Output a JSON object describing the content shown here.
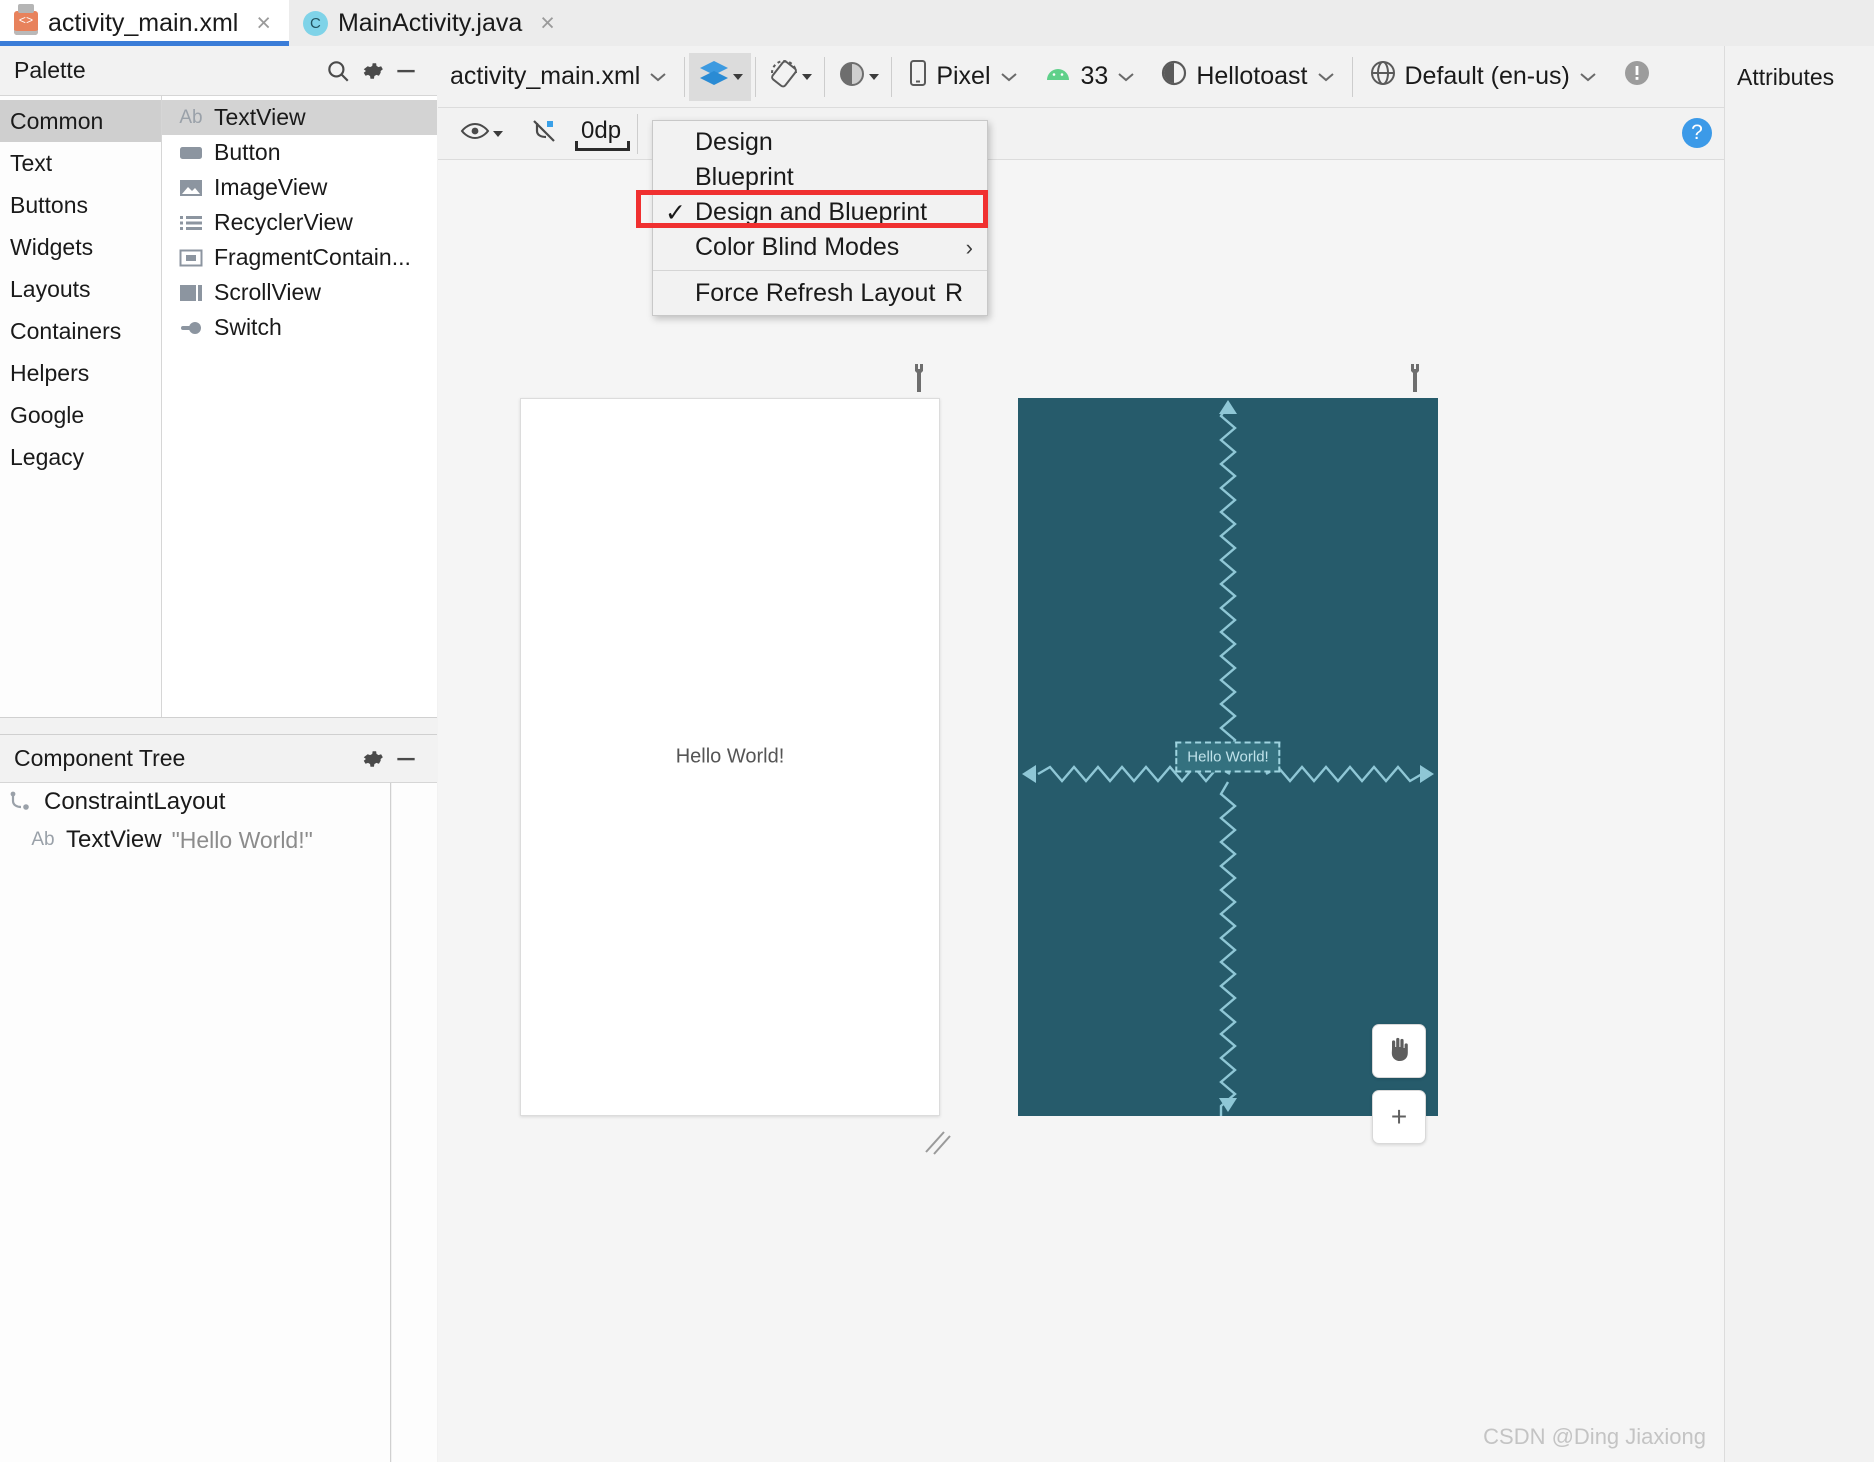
{
  "tabs": [
    {
      "label": "activity_main.xml",
      "icon": "xml-file-icon",
      "active": true,
      "close": "×"
    },
    {
      "label": "MainActivity.java",
      "icon": "java-class-icon",
      "active": false,
      "close": "×"
    }
  ],
  "palette": {
    "title": "Palette",
    "search_icon": "search-icon",
    "gear_icon": "gear-icon",
    "minimize_icon": "minimize-icon",
    "categories": [
      {
        "label": "Common",
        "selected": true
      },
      {
        "label": "Text",
        "selected": false
      },
      {
        "label": "Buttons",
        "selected": false
      },
      {
        "label": "Widgets",
        "selected": false
      },
      {
        "label": "Layouts",
        "selected": false
      },
      {
        "label": "Containers",
        "selected": false
      },
      {
        "label": "Helpers",
        "selected": false
      },
      {
        "label": "Google",
        "selected": false
      },
      {
        "label": "Legacy",
        "selected": false
      }
    ],
    "widgets": [
      {
        "label": "TextView",
        "icon": "textview-icon",
        "selected": true
      },
      {
        "label": "Button",
        "icon": "button-icon",
        "selected": false
      },
      {
        "label": "ImageView",
        "icon": "imageview-icon",
        "selected": false
      },
      {
        "label": "RecyclerView",
        "icon": "recyclerview-icon",
        "selected": false
      },
      {
        "label": "FragmentContain...",
        "icon": "fragmentcontainer-icon",
        "selected": false
      },
      {
        "label": "ScrollView",
        "icon": "scrollview-icon",
        "selected": false
      },
      {
        "label": "Switch",
        "icon": "switch-icon",
        "selected": false
      }
    ]
  },
  "component_tree": {
    "title": "Component Tree",
    "gear_icon": "gear-icon",
    "minimize_icon": "minimize-icon",
    "nodes": [
      {
        "label": "ConstraintLayout",
        "value": "",
        "icon": "constraintlayout-icon",
        "level": 0
      },
      {
        "label": "TextView",
        "value": "\"Hello World!\"",
        "icon": "textview-icon",
        "level": 1
      }
    ]
  },
  "toolbar": {
    "file_selector": "activity_main.xml",
    "surface_mode_icon": "design-surface-layers-icon",
    "orientation_icon": "rotate-device-icon",
    "theme_icon": "theme-contrast-icon",
    "device": "Pixel",
    "device_icon": "phone-icon",
    "api_level": "33",
    "api_icon": "android-icon",
    "theme": "Hellotoast",
    "locale": "Default (en-us)",
    "locale_icon": "globe-icon",
    "issues_icon": "warning-icon",
    "attributes_label": "Attributes"
  },
  "subtoolbar": {
    "view_options_icon": "eye-icon",
    "constraints_icon": "hide-constraints-icon",
    "default_margin": "0dp",
    "clear_constraints_icon": "clear-constraints-icon",
    "help_icon": "help-icon",
    "help_label": "?"
  },
  "menu": {
    "items": [
      {
        "label": "Design",
        "checked": false,
        "submenu": false,
        "shortcut": ""
      },
      {
        "label": "Blueprint",
        "checked": false,
        "submenu": false,
        "shortcut": ""
      },
      {
        "label": "Design and Blueprint",
        "checked": true,
        "submenu": false,
        "shortcut": "",
        "highlighted": true
      },
      {
        "label": "Color Blind Modes",
        "checked": false,
        "submenu": true,
        "shortcut": ""
      },
      {
        "label": "Force Refresh Layout",
        "checked": false,
        "submenu": false,
        "shortcut": "R"
      }
    ],
    "check_glyph": "✓",
    "submenu_glyph": "›"
  },
  "canvas": {
    "design_preview_text": "Hello World!",
    "blueprint_preview_text": "Hello World!",
    "design_wrench_icon": "wrench-icon",
    "blueprint_wrench_icon": "wrench-icon",
    "pan_tool_icon": "pan-hand-icon",
    "zoom_in_label": "+",
    "resize_handle_icon": "resize-handle-icon",
    "blueprint_bg": "#265b6b",
    "watermark": "CSDN @Ding Jiaxiong"
  }
}
